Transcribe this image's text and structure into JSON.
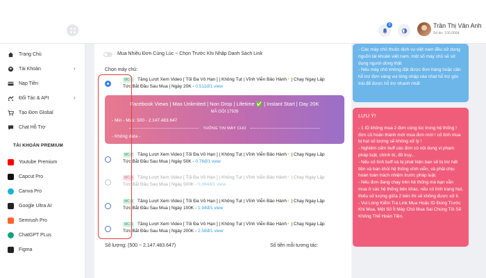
{
  "header": {
    "user_name": "Trần Thị Vân Anh",
    "user_balance": "Số dư: 100,000đ",
    "notification_count": "0"
  },
  "sidebar": {
    "items": [
      {
        "label": "Trang Chủ",
        "icon": "home-icon",
        "has_chevron": false
      },
      {
        "label": "Tài Khoản",
        "icon": "account-icon",
        "has_chevron": true
      },
      {
        "label": "Nạp Tiền",
        "icon": "card-icon",
        "has_chevron": false
      },
      {
        "label": "Đối Tác & API",
        "icon": "partner-icon",
        "has_chevron": true
      },
      {
        "label": "Tạo Đơn Global",
        "icon": "cart-icon",
        "has_chevron": false
      },
      {
        "label": "Chat Hỗ Trợ",
        "icon": "chat-icon",
        "has_chevron": false
      }
    ],
    "premium_title": "TÀI KHOẢN PREMIUM",
    "premium_items": [
      {
        "label": "Youtube Premium",
        "icon": "youtube-icon",
        "color": "#ff0000"
      },
      {
        "label": "Capcut Pro",
        "icon": "capcut-icon",
        "color": "#111111"
      },
      {
        "label": "Canva Pro",
        "icon": "canva-icon",
        "color": "#19b3d6"
      },
      {
        "label": "Google Ultra AI",
        "icon": "google-ai-icon",
        "color": "#222222"
      },
      {
        "label": "Semrush Pro",
        "icon": "semrush-icon",
        "color": "#ff642d"
      },
      {
        "label": "ChatGPT PLus",
        "icon": "chatgpt-icon",
        "color": "#10a37f"
      },
      {
        "label": "Figma",
        "icon": "figma-icon",
        "color": "#222222"
      }
    ]
  },
  "order": {
    "multi_toggle_label": "Mua Nhiều Đơn Cùng Lúc ~ Chọn Trước Khi Nhập Danh Sách Link",
    "choose_server_label": "Chọn máy chủ:",
    "servers": [
      {
        "tag": "MC-1",
        "line1": "Tăng Lượt Xem Video [ Tối Đa Vô Hạn ] | Không Tụt | Vĩnh Viễn Bảo Hành",
        "line1_tail": " | Chạy Ngay Lập",
        "line2": "Tức Bắt Đầu Sau Mua | Ngày 20K - ",
        "price": "0.511đ/1 view",
        "selected": true,
        "disabled": false
      },
      {
        "tag": "MC-2",
        "line1": "Tăng Lượt Xem Video [ Tối Đa Vô Hạn ] | Không Tụt | Vĩnh Viễn Bảo Hành",
        "line1_tail": " | Chạy Ngay Lập",
        "line2": "Tức Bắt Đầu Sau Mua | Ngày 50K - ",
        "price": "0.76đ/1 view",
        "selected": false,
        "disabled": false
      },
      {
        "tag": "MC-3",
        "line1": "Tăng Lượt Xem Video [ Tối Đa Vô Hạn ] | Không Tụt | Vĩnh Viễn Bảo Hành",
        "line1_tail": " | Chạy Ngay Lập",
        "line2": "Tức Bắt Đầu Sau Mua | Ngày 500K - ",
        "price": "0.084đ/1 view",
        "selected": false,
        "disabled": true
      },
      {
        "tag": "MC-4",
        "line1": "Tăng Lượt Xem Video [ Tối Đa Vô Hạn ] | Không Tụt | Vĩnh Viễn Bảo Hành",
        "line1_tail": " | Chạy Ngay Lập",
        "line2": "Tức Bắt Đầu Sau Mua | Ngày 100K - ",
        "price": "1.94đ/1 view",
        "selected": false,
        "disabled": false
      },
      {
        "tag": "MC-5",
        "line1": "Tăng Lượt Xem Video [ Tối Đa Vô Hạn ] | Không Tụt | Vĩnh Viễn Bảo Hành",
        "line1_tail": " | Chạy Ngay Lập",
        "line2": "Tức Bắt Đầu Sau Mua | Ngày 200K - ",
        "price": "2.58đ/1 view",
        "selected": false,
        "disabled": false
      }
    ],
    "detail": {
      "title": "Facebook Views | Max Unlimited | Non Drop | Lifetime ✅ | Instant Start | Day 20K",
      "code": "MÃ GÓI 17926",
      "minmax": "- Min - Max: 500 - 2.147.483.647",
      "info_title": "THÔNG TIN MÁY CHỦ",
      "data_line": "- Không data -"
    },
    "quantity_label": "Số lượng: (500 ~ 2.147.483.647)",
    "total_label": "Số tiền mỗi tương tác:"
  },
  "notice_blue": [
    "- Các máy chủ thuộc dịch vụ việt nam đều sử dụng nguồn tài khoản việt nam, một số máy chủ sẽ sử dụng người dùng thật",
    "- Nếu máy chủ không đặt được đơn hàng hoặc cần hỗ trợ đơn vàng vui lòng nhập vào chat hỗ trợ góc trái để được hỗ trợ nhanh nhất"
  ],
  "notice_red": {
    "title": "LƯU Ý!",
    "lines": [
      "- 1 ID không mua 2 đơn cùng lúc trong hệ thống ! đơn cũ hoàn thành mới mua đơn mới ! cố tình mua bị hụt số lượng sẽ không xử lý !",
      "- Nghiêm cấm buff các đơn có nội dung vi phạm pháp luật, chính trị, đồ trụy...",
      "- Nếu cố tình buff và bị phát hiện bạn sẽ bị trừ hết tiền và ban khỏi hệ thống vĩnh viễn, và phải chịu hoàn toàn trách nhiệm trước pháp luật.",
      "- Nếu đơn đang chạy trên hệ thống mà bạn vẫn mua ở các hệ thống bên khác, nếu có tình trạng hụt, thiếu số lượng giữa 2 bên thì sẽ không được xử lí.",
      "- Vui Lòng Kiểm Tra Link Mua Hoặc ID Đúng Trước Khi Mua, Một Số Ít Máy Chủ Mua Sai Chúng Tôi Sẽ Không Thể Hoàn Tiền."
    ]
  },
  "colors": {
    "accent": "#2f80ed",
    "highlight_box": "#e23d3d",
    "notice_red": "#f05d7a",
    "notice_blue": "#6cb6ea"
  }
}
